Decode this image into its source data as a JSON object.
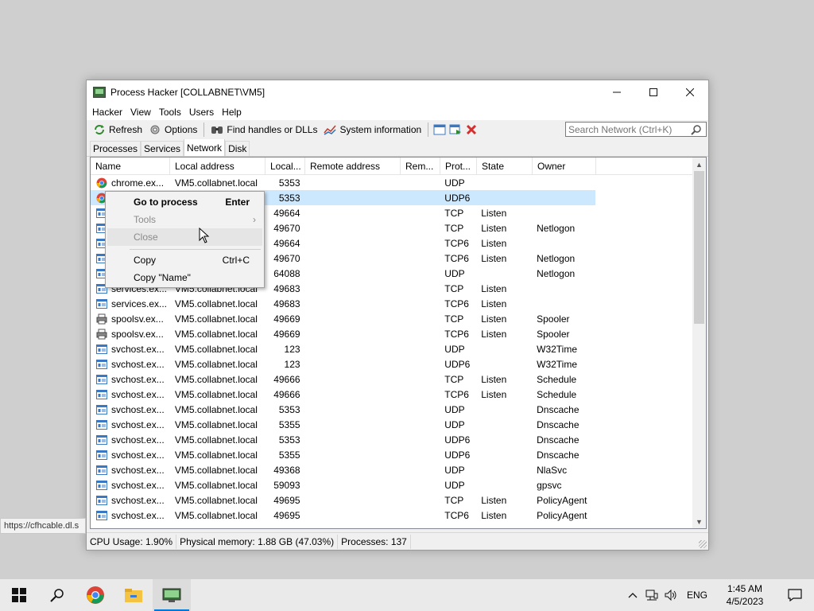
{
  "window": {
    "title": "Process Hacker [COLLABNET\\VM5]",
    "controls": {
      "minimize": "—",
      "maximize": "☐",
      "close": "✕"
    }
  },
  "menu": [
    "Hacker",
    "View",
    "Tools",
    "Users",
    "Help"
  ],
  "toolbar": {
    "refresh": "Refresh",
    "options": "Options",
    "find_handles": "Find handles or DLLs",
    "system_info": "System information",
    "search_placeholder": "Search Network (Ctrl+K)"
  },
  "tabs": [
    "Processes",
    "Services",
    "Network",
    "Disk"
  ],
  "active_tab": "Network",
  "columns": [
    "Name",
    "Local address",
    "Local...",
    "Remote address",
    "Rem...",
    "Prot...",
    "State",
    "Owner"
  ],
  "rows": [
    {
      "name": "chrome.ex...",
      "icon": "chrome-icon",
      "local": "VM5.collabnet.local",
      "port": "5353",
      "remote": "",
      "remport": "",
      "proto": "UDP",
      "state": "",
      "owner": ""
    },
    {
      "name": "",
      "icon": "chrome-icon",
      "local": "",
      "port": "5353",
      "remote": "",
      "remport": "",
      "proto": "UDP6",
      "state": "",
      "owner": "",
      "selected": true
    },
    {
      "name": "",
      "icon": "window-icon",
      "local": "",
      "port": "49664",
      "remote": "",
      "remport": "",
      "proto": "TCP",
      "state": "Listen",
      "owner": ""
    },
    {
      "name": "",
      "icon": "window-icon",
      "local": "",
      "port": "49670",
      "remote": "",
      "remport": "",
      "proto": "TCP",
      "state": "Listen",
      "owner": "Netlogon"
    },
    {
      "name": "",
      "icon": "window-icon",
      "local": "",
      "port": "49664",
      "remote": "",
      "remport": "",
      "proto": "TCP6",
      "state": "Listen",
      "owner": ""
    },
    {
      "name": "",
      "icon": "window-icon",
      "local": "",
      "port": "49670",
      "remote": "",
      "remport": "",
      "proto": "TCP6",
      "state": "Listen",
      "owner": "Netlogon"
    },
    {
      "name": "",
      "icon": "window-icon",
      "local": "",
      "port": "64088",
      "remote": "",
      "remport": "",
      "proto": "UDP",
      "state": "",
      "owner": "Netlogon"
    },
    {
      "name": "services.ex...",
      "icon": "window-icon",
      "local": "VM5.collabnet.local",
      "port": "49683",
      "remote": "",
      "remport": "",
      "proto": "TCP",
      "state": "Listen",
      "owner": ""
    },
    {
      "name": "services.ex...",
      "icon": "window-icon",
      "local": "VM5.collabnet.local",
      "port": "49683",
      "remote": "",
      "remport": "",
      "proto": "TCP6",
      "state": "Listen",
      "owner": ""
    },
    {
      "name": "spoolsv.ex...",
      "icon": "printer-icon",
      "local": "VM5.collabnet.local",
      "port": "49669",
      "remote": "",
      "remport": "",
      "proto": "TCP",
      "state": "Listen",
      "owner": "Spooler"
    },
    {
      "name": "spoolsv.ex...",
      "icon": "printer-icon",
      "local": "VM5.collabnet.local",
      "port": "49669",
      "remote": "",
      "remport": "",
      "proto": "TCP6",
      "state": "Listen",
      "owner": "Spooler"
    },
    {
      "name": "svchost.ex...",
      "icon": "window-icon",
      "local": "VM5.collabnet.local",
      "port": "123",
      "remote": "",
      "remport": "",
      "proto": "UDP",
      "state": "",
      "owner": "W32Time"
    },
    {
      "name": "svchost.ex...",
      "icon": "window-icon",
      "local": "VM5.collabnet.local",
      "port": "123",
      "remote": "",
      "remport": "",
      "proto": "UDP6",
      "state": "",
      "owner": "W32Time"
    },
    {
      "name": "svchost.ex...",
      "icon": "window-icon",
      "local": "VM5.collabnet.local",
      "port": "49666",
      "remote": "",
      "remport": "",
      "proto": "TCP",
      "state": "Listen",
      "owner": "Schedule"
    },
    {
      "name": "svchost.ex...",
      "icon": "window-icon",
      "local": "VM5.collabnet.local",
      "port": "49666",
      "remote": "",
      "remport": "",
      "proto": "TCP6",
      "state": "Listen",
      "owner": "Schedule"
    },
    {
      "name": "svchost.ex...",
      "icon": "window-icon",
      "local": "VM5.collabnet.local",
      "port": "5353",
      "remote": "",
      "remport": "",
      "proto": "UDP",
      "state": "",
      "owner": "Dnscache"
    },
    {
      "name": "svchost.ex...",
      "icon": "window-icon",
      "local": "VM5.collabnet.local",
      "port": "5355",
      "remote": "",
      "remport": "",
      "proto": "UDP",
      "state": "",
      "owner": "Dnscache"
    },
    {
      "name": "svchost.ex...",
      "icon": "window-icon",
      "local": "VM5.collabnet.local",
      "port": "5353",
      "remote": "",
      "remport": "",
      "proto": "UDP6",
      "state": "",
      "owner": "Dnscache"
    },
    {
      "name": "svchost.ex...",
      "icon": "window-icon",
      "local": "VM5.collabnet.local",
      "port": "5355",
      "remote": "",
      "remport": "",
      "proto": "UDP6",
      "state": "",
      "owner": "Dnscache"
    },
    {
      "name": "svchost.ex...",
      "icon": "window-icon",
      "local": "VM5.collabnet.local",
      "port": "49368",
      "remote": "",
      "remport": "",
      "proto": "UDP",
      "state": "",
      "owner": "NlaSvc"
    },
    {
      "name": "svchost.ex...",
      "icon": "window-icon",
      "local": "VM5.collabnet.local",
      "port": "59093",
      "remote": "",
      "remport": "",
      "proto": "UDP",
      "state": "",
      "owner": "gpsvc"
    },
    {
      "name": "svchost.ex...",
      "icon": "window-icon",
      "local": "VM5.collabnet.local",
      "port": "49695",
      "remote": "",
      "remport": "",
      "proto": "TCP",
      "state": "Listen",
      "owner": "PolicyAgent"
    },
    {
      "name": "svchost.ex...",
      "icon": "window-icon",
      "local": "VM5.collabnet.local",
      "port": "49695",
      "remote": "",
      "remport": "",
      "proto": "TCP6",
      "state": "Listen",
      "owner": "PolicyAgent"
    }
  ],
  "context_menu": {
    "go_to_process": "Go to process",
    "go_to_process_shortcut": "Enter",
    "tools": "Tools",
    "close": "Close",
    "copy": "Copy",
    "copy_shortcut": "Ctrl+C",
    "copy_name": "Copy \"Name\""
  },
  "status": {
    "cpu": "CPU Usage: 1.90%",
    "memory": "Physical memory: 1.88 GB (47.03%)",
    "processes": "Processes: 137"
  },
  "url_tooltip": "https://cfhcable.dl.s",
  "taskbar": {
    "lang": "ENG",
    "time": "1:45 AM",
    "date": "4/5/2023"
  },
  "colors": {
    "selection": "#cce8ff",
    "accent": "#0078d7"
  }
}
